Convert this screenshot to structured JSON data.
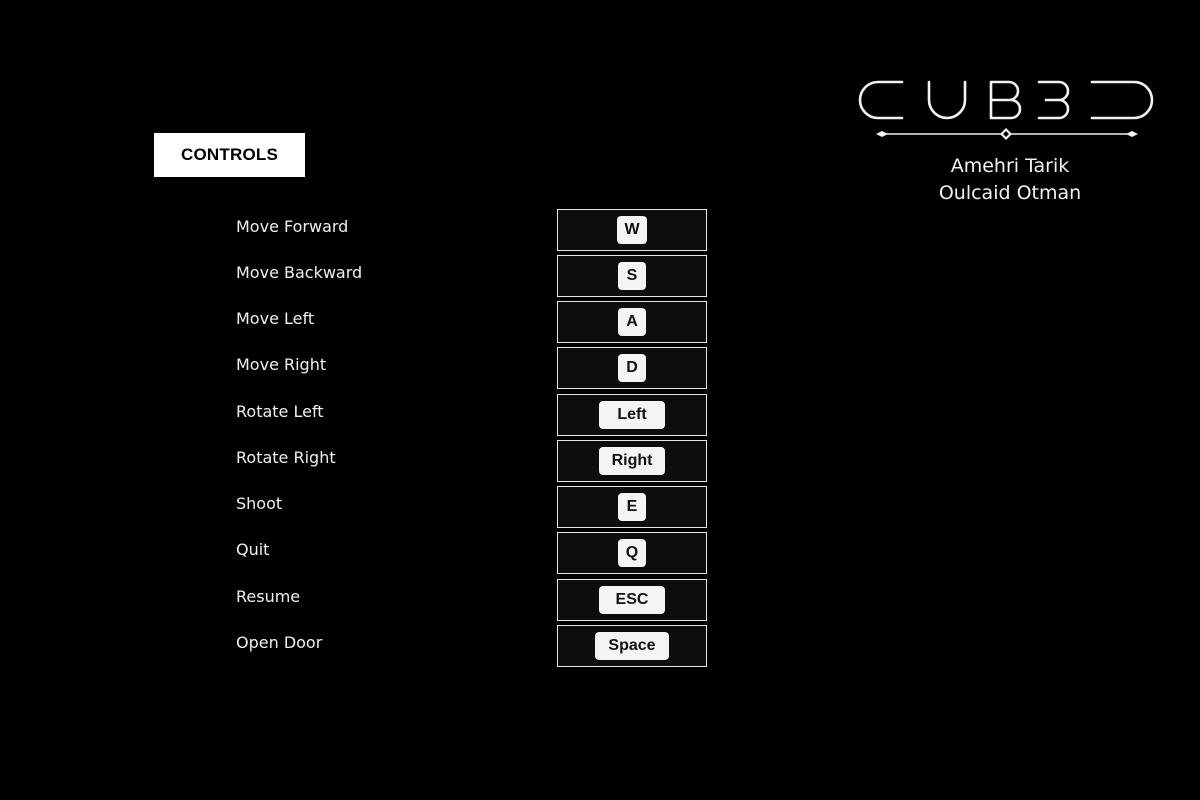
{
  "header": {
    "controls_label": "CONTROLS"
  },
  "logo": {
    "text": "CUB3D"
  },
  "credits": {
    "author_1": "Amehri Tarik",
    "author_2": "Oulcaid Otman"
  },
  "controls": [
    {
      "action": "Move Forward",
      "key": "W"
    },
    {
      "action": "Move Backward",
      "key": "S"
    },
    {
      "action": "Move Left",
      "key": "A"
    },
    {
      "action": "Move Right",
      "key": "D"
    },
    {
      "action": "Rotate Left",
      "key": "Left"
    },
    {
      "action": "Rotate Right",
      "key": "Right"
    },
    {
      "action": "Shoot",
      "key": "E"
    },
    {
      "action": "Quit",
      "key": "Q"
    },
    {
      "action": "Resume",
      "key": "ESC"
    },
    {
      "action": "Open Door",
      "key": "Space"
    }
  ],
  "colors": {
    "background": "#000000",
    "text": "#f2f2f2",
    "keycap": "#f4f4f4",
    "key_cell_border": "#e6e6e6"
  }
}
